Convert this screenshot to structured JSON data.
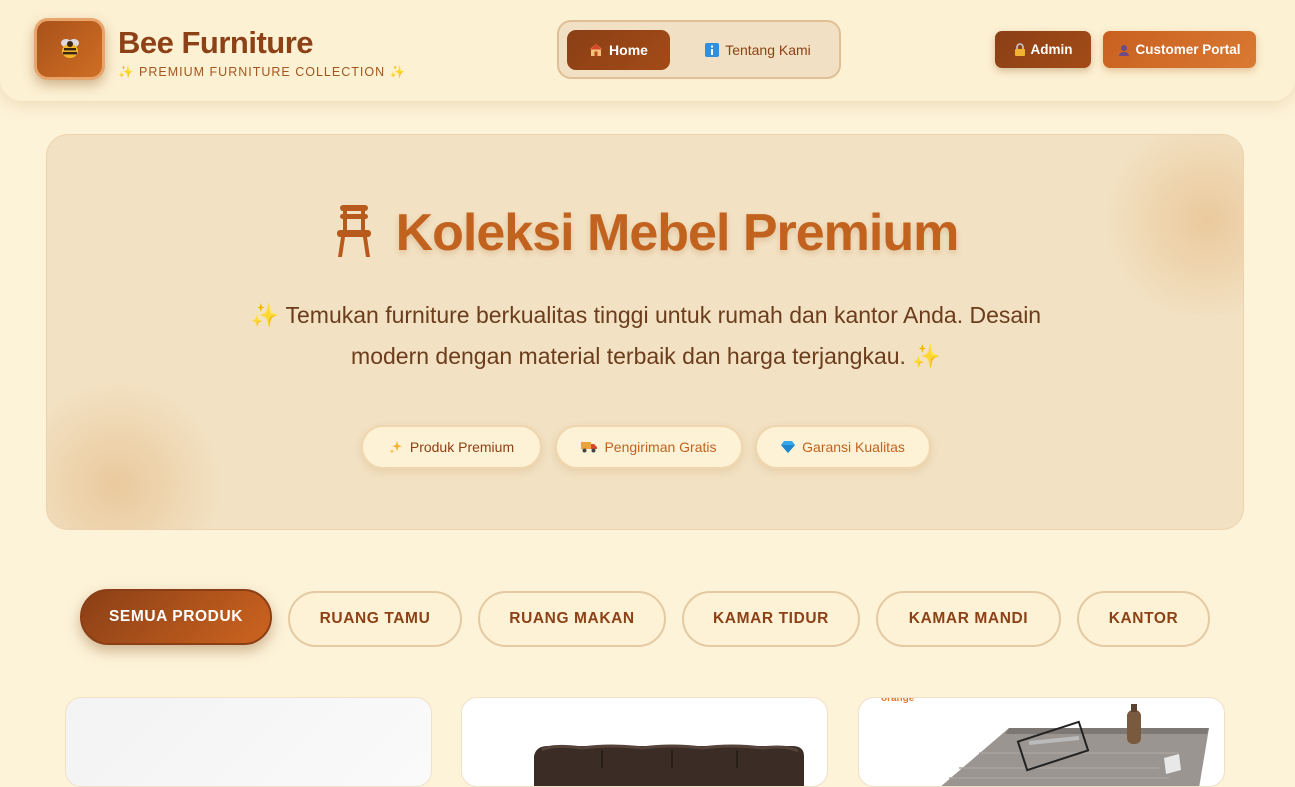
{
  "header": {
    "brand_title": "Bee Furniture",
    "brand_subtitle": "✨ PREMIUM FURNITURE COLLECTION ✨",
    "nav": [
      {
        "label": "Home",
        "icon": "house-icon",
        "active": true
      },
      {
        "label": "Tentang Kami",
        "icon": "info-icon",
        "active": false
      }
    ],
    "admin_label": "Admin",
    "portal_label": "Customer Portal"
  },
  "hero": {
    "title": "Koleksi Mebel Premium",
    "description": "✨ Temukan furniture berkualitas tinggi untuk rumah dan kantor Anda. Desain modern dengan material terbaik dan harga terjangkau. ✨",
    "badges": [
      {
        "label": "Produk Premium",
        "icon": "sparkles-icon"
      },
      {
        "label": "Pengiriman Gratis",
        "icon": "truck-icon"
      },
      {
        "label": "Garansi Kualitas",
        "icon": "gem-icon"
      }
    ]
  },
  "categories": [
    "SEMUA PRODUK",
    "RUANG TAMU",
    "RUANG MAKAN",
    "KAMAR TIDUR",
    "KAMAR MANDI",
    "KANTOR"
  ],
  "active_category": "SEMUA PRODUK",
  "products": [
    {
      "image": "product-image-placeholder"
    },
    {
      "image": "leather-sofa-image"
    },
    {
      "image": "coffee-table-image",
      "brand_text": "orange"
    }
  ],
  "colors": {
    "background": "#fdf3d9",
    "primary": "#8c4117",
    "accent": "#c2621f",
    "hero_bg": "#f2e1c2"
  }
}
